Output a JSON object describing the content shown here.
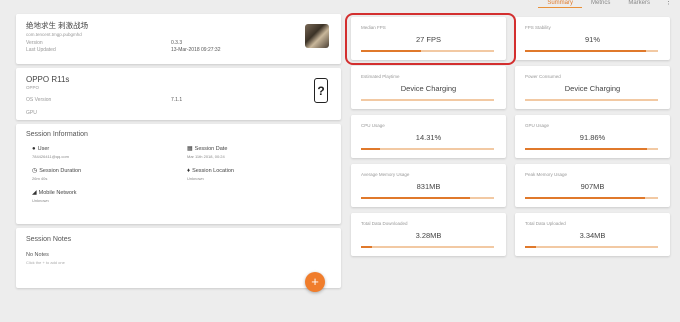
{
  "tabs": [
    {
      "label": "Summary",
      "active": true
    },
    {
      "label": "Metrics",
      "active": false
    },
    {
      "label": "Markers",
      "active": false
    }
  ],
  "more_icon": "⋮",
  "game": {
    "name": "绝地求生 刺激战场",
    "package": "com.tencent.tmgp.pubgmhd",
    "version_label": "Version",
    "version": "0.3.3",
    "updated_label": "Last Updated",
    "updated": "13-Mar-2018 09:27:32"
  },
  "device": {
    "name": "OPPO R11s",
    "brand": "OPPO",
    "os_label": "OS Version",
    "os": "7.1.1",
    "gpu_label": "GPU",
    "gpu": ""
  },
  "session": {
    "title": "Session Information",
    "user_label": "User",
    "user": "784426411@qq.com",
    "date_label": "Session Date",
    "date": "Mar 11th 2018, 00:24",
    "duration_label": "Session Duration",
    "duration": "26m 40s",
    "location_label": "Session Location",
    "location": "Unknown",
    "network_label": "Mobile Network",
    "network": "Unknown"
  },
  "notes": {
    "title": "Session Notes",
    "empty": "No Notes",
    "hint": "Click the + to add one",
    "fab": "+"
  },
  "metrics": [
    {
      "label": "Median FPS",
      "value": "27 FPS",
      "fill": 0.45
    },
    {
      "label": "FPS Stability",
      "value": "91%",
      "fill": 0.91
    },
    {
      "label": "Estimated Playtime",
      "value": "Device Charging",
      "fill": 0
    },
    {
      "label": "Power Consumed",
      "value": "Device Charging",
      "fill": 0
    },
    {
      "label": "CPU Usage",
      "value": "14.31%",
      "fill": 0.14
    },
    {
      "label": "GPU Usage",
      "value": "91.86%",
      "fill": 0.92
    },
    {
      "label": "Average Memory Usage",
      "value": "831MB",
      "fill": 0.82
    },
    {
      "label": "Peak Memory Usage",
      "value": "907MB",
      "fill": 0.9
    },
    {
      "label": "Total Data Downloaded",
      "value": "3.28MB",
      "fill": 0.08
    },
    {
      "label": "Total Data Uploaded",
      "value": "3.34MB",
      "fill": 0.08
    }
  ],
  "icons": {
    "user": "person-icon",
    "date": "calendar-icon",
    "duration": "clock-icon",
    "location": "location-pin-icon",
    "network": "signal-icon",
    "device": "phone-unknown-icon"
  },
  "colors": {
    "accent": "#e0792b",
    "highlight": "#d32f2f"
  }
}
